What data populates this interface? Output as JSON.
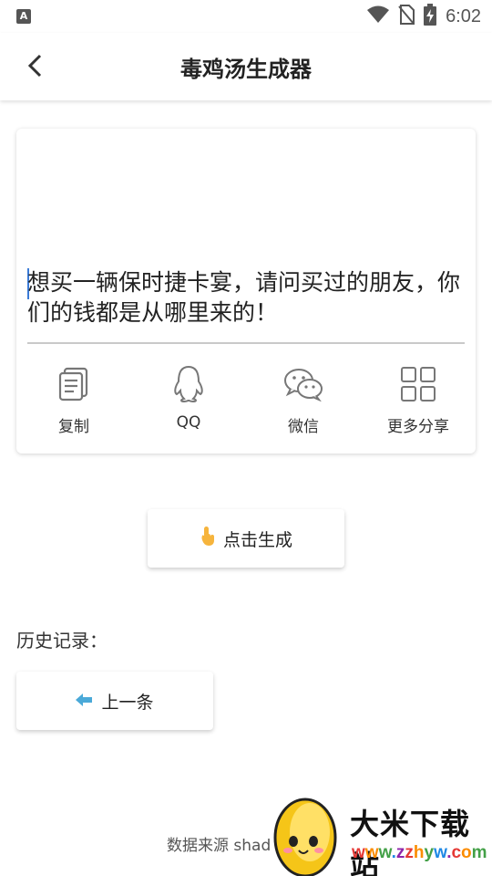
{
  "status_bar": {
    "app_badge": "A",
    "time": "6:02",
    "icons": [
      "wifi-icon",
      "no-sim-icon",
      "battery-charging-icon"
    ]
  },
  "app_bar": {
    "title": "毒鸡汤生成器",
    "back_icon": "chevron-left-icon"
  },
  "quote_card": {
    "text": "想买一辆保时捷卡宴，请问买过的朋友，你们的钱都是从哪里来的！",
    "share_actions": [
      {
        "label": "复制",
        "icon": "copy-icon"
      },
      {
        "label": "QQ",
        "icon": "qq-penguin-icon"
      },
      {
        "label": "微信",
        "icon": "wechat-icon"
      },
      {
        "label": "更多分享",
        "icon": "grid-icon"
      }
    ]
  },
  "generate_button": {
    "label": "点击生成",
    "icon": "pointing-hand-icon"
  },
  "history": {
    "label": "历史记录：",
    "prev_button": {
      "label": "上一条",
      "icon": "arrow-left-icon"
    }
  },
  "footer": {
    "source_text": "数据来源 shad"
  },
  "watermark": {
    "title": "大米下载站",
    "url": "www.zzhyw.com",
    "url_colors": [
      "#e53935",
      "#fb8c00",
      "#43a047",
      "#1e88e5",
      "#8e24aa"
    ]
  },
  "colors": {
    "accent": "#3b7bd6",
    "icon_gray": "#777777",
    "arrow_blue": "#4aa9d8"
  }
}
